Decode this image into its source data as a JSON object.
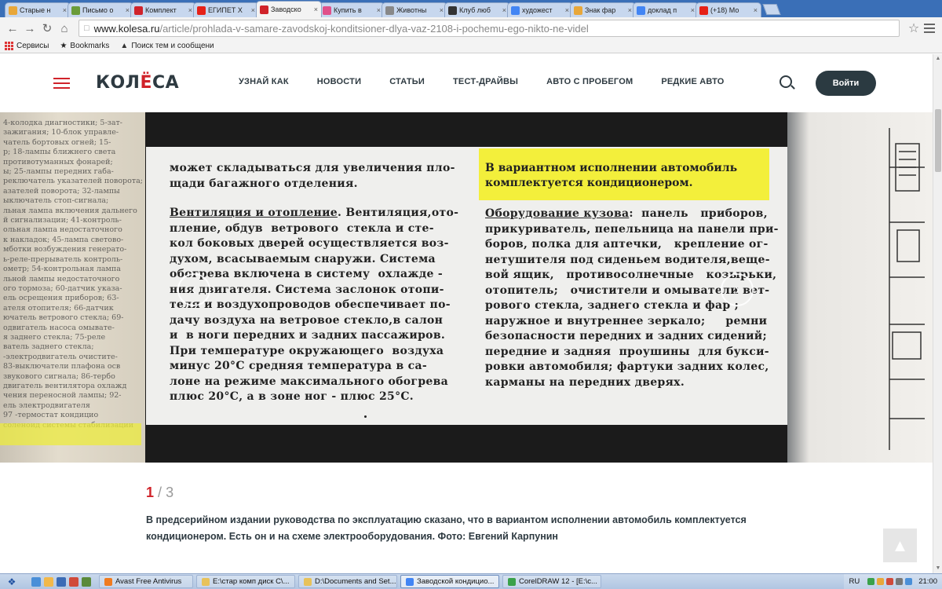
{
  "browser": {
    "tabs": [
      {
        "label": "Старые н",
        "favicon_color": "#e8a73a",
        "active": false
      },
      {
        "label": "Письмо о",
        "favicon_color": "#6a9c3a",
        "active": false
      },
      {
        "label": "Комплект",
        "favicon_color": "#d0232a",
        "active": false
      },
      {
        "label": "ЕГИПЕТ Х",
        "favicon_color": "#e62117",
        "active": false
      },
      {
        "label": "Заводско",
        "favicon_color": "#d0232a",
        "active": true
      },
      {
        "label": "Купить в",
        "favicon_color": "#e0508a",
        "active": false
      },
      {
        "label": "Животны",
        "favicon_color": "#888888",
        "active": false
      },
      {
        "label": "Клуб люб",
        "favicon_color": "#333333",
        "active": false
      },
      {
        "label": "художест",
        "favicon_color": "#4285f4",
        "active": false
      },
      {
        "label": "Знак фар",
        "favicon_color": "#e8a73a",
        "active": false
      },
      {
        "label": "доклад п",
        "favicon_color": "#4285f4",
        "active": false
      },
      {
        "label": "(+18) Мо",
        "favicon_color": "#e62117",
        "active": false
      }
    ],
    "url_domain": "www.kolesa.ru",
    "url_path": "/article/prohlada-v-samare-zavodskoj-konditsioner-dlya-vaz-2108-i-pochemu-ego-nikto-ne-videl",
    "bookmarks": [
      {
        "label": "Сервисы",
        "icon": "apps-grid-icon"
      },
      {
        "label": "Bookmarks",
        "icon": "star-icon"
      },
      {
        "label": "Поиск тем и сообщени",
        "icon": "forum-icon"
      }
    ]
  },
  "site": {
    "logo_left": "КОЛ",
    "logo_accent": "Ё",
    "logo_right": "СА",
    "nav": [
      "УЗНАЙ КАК",
      "НОВОСТИ",
      "СТАТЬИ",
      "ТЕСТ-ДРАЙВЫ",
      "АВТО С ПРОБЕГОМ",
      "РЕДКИЕ АВТО"
    ],
    "login_label": "Войти",
    "brand_color": "#d0232a",
    "dark_color": "#2e3a41"
  },
  "gallery": {
    "current": "1",
    "separator": "/",
    "total": "3",
    "caption": "В предсерийном издании руководства по эксплуатацию сказано, что в вариантом исполнении автомобиль комплектуется кондиционером. Есть он и на схеме электрооборудования. Фото: Евгений Карпунин",
    "scan_left_top": [
      "может складываться для увеличения пло-",
      "щади багажного отделения."
    ],
    "scan_left_heading": "Вентиляция и отопление",
    "scan_left_body": [
      ". Вентиляция,ото-",
      "пление, обдув  ветрового  стекла и сте-",
      "кол боковых дверей осуществляется воз-",
      "духом, всасываемым снаружи. Система",
      "обогрева включена в систему  охлажде -",
      "ния двигателя. Система заслонок отопи-",
      "теля и воздухопроводов обеспечивает по-",
      "дачу воздуха на ветровое стекло,в салон",
      "и  в ноги передних и задних пассажиров.",
      "При температуре окружающего  воздуха",
      "минус 20°С средняя температура в са-",
      "лоне на режиме максимального обогрева",
      "плюс 20°С, а в зоне ног - плюс 25°С."
    ],
    "scan_highlight": [
      "В вариантном исполнении автомобиль",
      "комплектуется кондиционером."
    ],
    "scan_right_heading": "Оборудование кузова",
    "scan_right_body": [
      ":  панель   приборов,",
      "прикуриватель, пепельница на панели при-",
      "боров, полка для аптечки,   крепление ог-",
      "нетушителя под сиденьем водителя,веще-",
      "вой ящик,   противосолнечные   козырьки,",
      "отопитель;   очистители и омыватели вет-",
      "рового стекла, заднего стекла и фар ;",
      "наружное и внутреннее зеркало;     ремни",
      "безопасности передних и задних сидений;",
      "передние и задняя  проушины  для букси-",
      "ровки автомобиля; фартуки задних колес,",
      "карманы на передних дверях."
    ],
    "side_left_text": [
      "4-колодка диагностики; 5-зат-",
      "зажигания; 10-блок управле-",
      "чатель бортовых огней; 15-",
      "р; 18-лампы ближнего света",
      "противотуманных фонарей;",
      "ы; 25-лампы передних габа-",
      "реключатель указателей поворота;",
      "азателей поворота; 32-лампы",
      "ыключатель стоп-сигнала;",
      "льная лампа включения дальнего",
      "й сигнализации; 41-контроль-",
      "ольная лампа недостаточного",
      "к накладок; 45-лампа светово-",
      "мботки возбуждения генерато-",
      "ь-реле-прерыватель контроль-",
      "ометр; 54-контрольная лампа",
      "льной лампы недостаточного",
      "ого тормоза; 60-датчик указа-",
      "ель осрещения приборов; 63-",
      "ателя отопителя; 66-датчик",
      "ючатель ветрового стекла; 69-",
      "одвигатель насоса омывате-",
      "я заднего стекла; 75-реле",
      "ватель заднего стекла;",
      "-электродвигатель очистите-",
      "83-выключатели плафона осв",
      "звукового сигнала; 86-тербо",
      "двигатель вентилятора охлажд",
      "чения переносной лампы; 92-",
      "ель электродвигателя",
      "97 -термостат кондицио",
      "соленоид системы стабилизации"
    ]
  },
  "taskbar": {
    "tasks": [
      {
        "label": "Avast Free Antivirus",
        "color": "#f07b1f"
      },
      {
        "label": "E:\\стар комп диск С\\...",
        "color": "#e8c25a"
      },
      {
        "label": "D:\\Documents and Set...",
        "color": "#e8c25a"
      },
      {
        "label": "Заводской кондицио...",
        "color": "#4285f4",
        "active": true
      },
      {
        "label": "CorelDRAW 12 - [E:\\c...",
        "color": "#3aa14a"
      }
    ],
    "lang": "RU",
    "time": "21:00"
  }
}
